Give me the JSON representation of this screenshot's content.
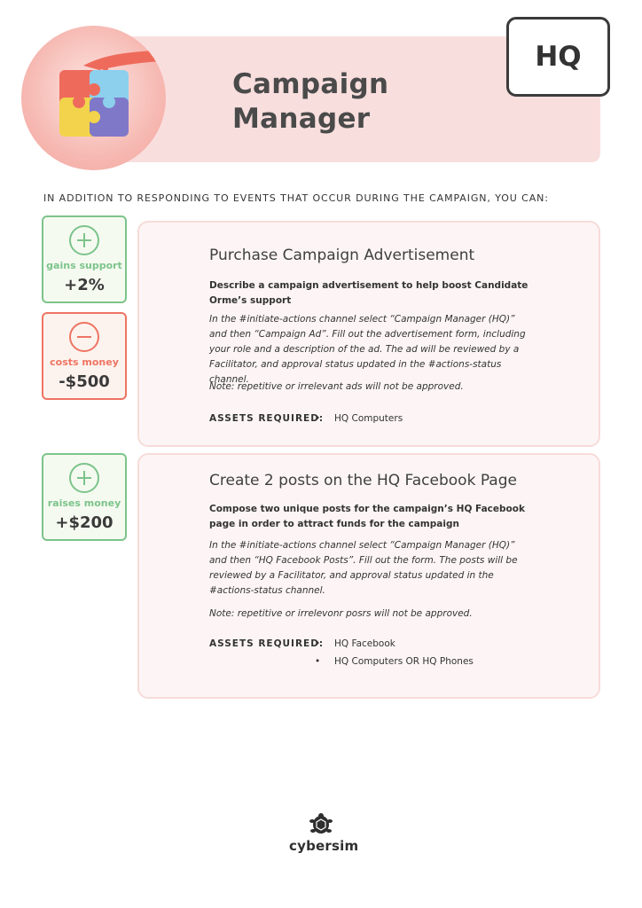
{
  "header": {
    "title_line1": "Campaign",
    "title_line2": "Manager",
    "role_badge": "HQ",
    "illustration": "puzzle-hand-icon"
  },
  "intro": "IN ADDITION TO RESPONDING TO EVENTS THAT OCCUR DURING THE CAMPAIGN, YOU CAN:",
  "actions": [
    {
      "title": "Purchase Campaign Advertisement",
      "description": "Describe a campaign advertisement to help boost Candidate Orme’s support",
      "instructions": "In the #initiate-actions channel select “Campaign Manager (HQ)” and then “Campaign Ad”. Fill out the advertisement form, including your role and a description of the ad. The ad will be reviewed by a Facilitator, and approval status updated in the #actions-status channel.",
      "note": "Note: repetitive or irrelevant ads will not be approved.",
      "assets_label": "ASSETS REQUIRED:",
      "assets": [
        "HQ Computers"
      ],
      "effects": [
        {
          "label": "gains support",
          "value": "+2%",
          "kind": "plus",
          "color": "#7cc48a"
        },
        {
          "label": "costs money",
          "value": "-$500",
          "kind": "minus",
          "color": "#ee7463"
        }
      ]
    },
    {
      "title": "Create 2 posts on the HQ Facebook Page",
      "description": "Compose two unique posts for the campaign’s HQ Facebook page in order to attract funds for the campaign",
      "instructions": "In the #initiate-actions channel select “Campaign Manager (HQ)” and then “HQ Facebook Posts”. Fill out the form. The posts will be reviewed by a Facilitator, and approval status updated in the #actions-status channel.",
      "note": "Note: repetitive or irrelevonr posrs will not be approved.",
      "assets_label": "ASSETS REQUIRED:",
      "assets": [
        "HQ Facebook",
        "HQ Computers OR HQ Phones"
      ],
      "effects": [
        {
          "label": "raises money",
          "value": "+$200",
          "kind": "plus",
          "color": "#7cc48a"
        }
      ]
    }
  ],
  "footer": {
    "brand": "cybersim",
    "logo_icon": "turtle-logo-icon"
  }
}
